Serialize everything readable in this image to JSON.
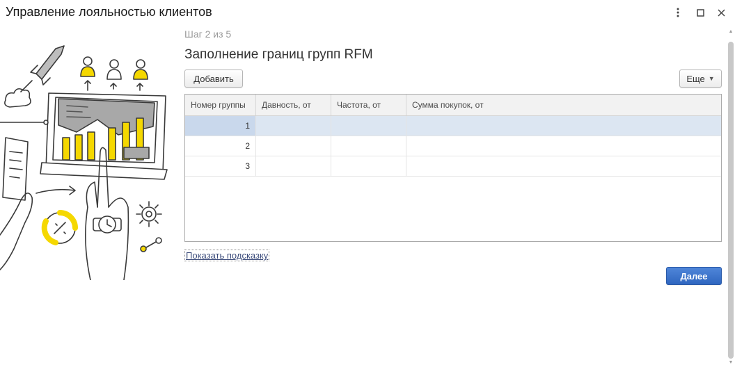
{
  "window": {
    "title": "Управление лояльностью клиентов"
  },
  "wizard": {
    "step": "Шаг 2 из 5",
    "heading": "Заполнение границ групп RFM"
  },
  "toolbar": {
    "add_label": "Добавить",
    "more_label": "Еще"
  },
  "table": {
    "columns": [
      "Номер группы",
      "Давность, от",
      "Частота, от",
      "Сумма покупок, от"
    ],
    "rows": [
      {
        "number": "1",
        "recency": "",
        "frequency": "",
        "amount": ""
      },
      {
        "number": "2",
        "recency": "",
        "frequency": "",
        "amount": ""
      },
      {
        "number": "3",
        "recency": "",
        "frequency": "",
        "amount": ""
      }
    ],
    "selected_row": 1
  },
  "hint_link": "Показать подсказку",
  "next_label": "Далее",
  "colors": {
    "accent": "#2f66bf",
    "illustration_yellow": "#f5d800",
    "selected_row": "#dce6f2"
  },
  "icons": [
    "more-vertical-icon",
    "maximize-icon",
    "close-icon",
    "chevron-down-icon"
  ]
}
